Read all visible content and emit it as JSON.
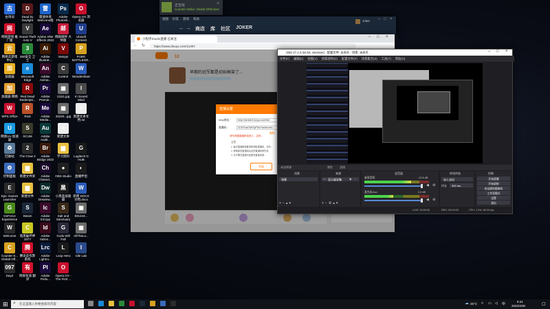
{
  "desktop": {
    "icons": [
      {
        "label": "古诗词",
        "color": "#2b6cd8",
        "glyph": "古"
      },
      {
        "label": "Dead by Daylight",
        "color": "#5a1a1a",
        "glyph": "D"
      },
      {
        "label": "雷速体育 Welcome版",
        "color": "#1e64c8",
        "glyph": "雷"
      },
      {
        "label": "Adobe Photosh...",
        "color": "#0a2a4a",
        "glyph": "Ps"
      },
      {
        "label": "Opera GX 浏览器",
        "color": "#c8102e",
        "glyph": "O"
      },
      {
        "label": "网易游戏 推广版",
        "color": "#d0102a",
        "glyph": "网"
      },
      {
        "label": "Grand Theft Auto V",
        "color": "#3a3a3a",
        "glyph": "V"
      },
      {
        "label": "Adobe After Effects 2022",
        "color": "#1a0a3a",
        "glyph": "Ae"
      },
      {
        "label": "网易邮件 大师版",
        "color": "#c81e3c",
        "glyph": "邮"
      },
      {
        "label": "Ubisoft Connect",
        "color": "#1e3c8c",
        "glyph": "U"
      },
      {
        "label": "网易云游戏 中心",
        "color": "#e0a020",
        "glyph": "云"
      },
      {
        "label": "360安全 卫士",
        "color": "#2a8a3a",
        "glyph": "3"
      },
      {
        "label": "Adobe Illustrat...",
        "color": "#3a1a00",
        "glyph": "Ai"
      },
      {
        "label": "Vampyr",
        "color": "#7a0a0a",
        "glyph": "V"
      },
      {
        "label": "PUBG BATTLEGR...",
        "color": "#d4a020",
        "glyph": "P"
      },
      {
        "label": "加速器",
        "color": "#e8b020",
        "glyph": "加"
      },
      {
        "label": "Microsoft Edge",
        "color": "#1a8ad8",
        "glyph": "e"
      },
      {
        "label": "Adobe Anima...",
        "color": "#3a0a2a",
        "glyph": "An"
      },
      {
        "label": "Control",
        "color": "#3a3a3a",
        "glyph": "C"
      },
      {
        "label": "Wondershare",
        "color": "#2a5ab8",
        "glyph": "W"
      },
      {
        "label": "加速器 网络",
        "color": "#e0a030",
        "glyph": "加"
      },
      {
        "label": "Red Dead Redempti...",
        "color": "#8a0a0a",
        "glyph": "R"
      },
      {
        "label": "Adobe Premie...",
        "color": "#1a0a3a",
        "glyph": "Pr"
      },
      {
        "label": "11111.jpg",
        "color": "#6a6a6a",
        "glyph": "▦"
      },
      {
        "label": "In Sound Mind",
        "color": "#4a4a4a",
        "glyph": "I"
      },
      {
        "label": "WPS Office",
        "color": "#c8102e",
        "glyph": "W"
      },
      {
        "label": "Rust",
        "color": "#b8502a",
        "glyph": "R"
      },
      {
        "label": "Adobe Media...",
        "color": "#1a0a3a",
        "glyph": "Me"
      },
      {
        "label": "20220...jpg",
        "color": "#6a6a6a",
        "glyph": "▦"
      },
      {
        "label": "新建文本文档.txt",
        "color": "#eeeeee",
        "glyph": "≡"
      },
      {
        "label": "网易UU 加速器",
        "color": "#1a9ae0",
        "glyph": "U"
      },
      {
        "label": "SCUM",
        "color": "#3a3a2a",
        "glyph": "S"
      },
      {
        "label": "Adobe Audit...",
        "color": "#0a3a3a",
        "glyph": "Au"
      },
      {
        "label": "新建文本",
        "color": "#eeeeee",
        "glyph": "≡"
      },
      {
        "label": "",
        "color": "#00000000",
        "glyph": ""
      },
      {
        "label": "回收站",
        "color": "#5a7a9a",
        "glyph": "♻"
      },
      {
        "label": "The Crew 2",
        "color": "#2a2a2a",
        "glyph": "2"
      },
      {
        "label": "Adobe Bridge 2022",
        "color": "#3a1a0a",
        "glyph": "Br"
      },
      {
        "label": "学习资料",
        "color": "#e8c040",
        "glyph": "▆"
      },
      {
        "label": "Logitech G HUB",
        "color": "#1a1a1a",
        "glyph": "G"
      },
      {
        "label": "控制面板",
        "color": "#3a6ab8",
        "glyph": "⚙"
      },
      {
        "label": "新建文件夹",
        "color": "#e8c040",
        "glyph": "▆"
      },
      {
        "label": "Adobe Charact...",
        "color": "#1a0a2a",
        "glyph": "Ch"
      },
      {
        "label": "OBS Studio",
        "color": "#202020",
        "glyph": "●"
      },
      {
        "label": "直播伴侣",
        "color": "#1a1a1a",
        "glyph": "◐"
      },
      {
        "label": "Epic Games Launcher",
        "color": "#2a2a2a",
        "glyph": "E"
      },
      {
        "label": "新建文件",
        "color": "#e8c040",
        "glyph": "▆"
      },
      {
        "label": "Adobe Dreamw...",
        "color": "#0a2a2a",
        "glyph": "Dw"
      },
      {
        "label": "小黑盒加速器",
        "color": "#1a1a1a",
        "glyph": "黑"
      },
      {
        "label": "新建 DOCX 文档.docx",
        "color": "#2a5ab8",
        "glyph": "W"
      },
      {
        "label": "GeForce Experience",
        "color": "#4a8a1a",
        "glyph": "G"
      },
      {
        "label": "Steam",
        "color": "#1b2838",
        "glyph": "S"
      },
      {
        "label": "Adobe InCopy",
        "color": "#3a0a2a",
        "glyph": "Ic"
      },
      {
        "label": "Salt and Sanctuary",
        "color": "#3a2a1a",
        "glyph": "S"
      },
      {
        "label": "831444...",
        "color": "#6a6a6a",
        "glyph": "▦"
      },
      {
        "label": "Welcome",
        "color": "#2a2a2a",
        "glyph": "W"
      },
      {
        "label": "暗黑破坏神2077",
        "color": "#c8c820",
        "glyph": "C"
      },
      {
        "label": "Adobe InDes...",
        "color": "#3a0a1a",
        "glyph": "Id"
      },
      {
        "label": "Gods Will Fall",
        "color": "#2a2a3a",
        "glyph": "G"
      },
      {
        "label": "AllTheLo...",
        "color": "#6a6a6a",
        "glyph": "▦"
      },
      {
        "label": "Counter-S... Global Off...",
        "color": "#d8a020",
        "glyph": "C"
      },
      {
        "label": "腾讯反作弊系统",
        "color": "#d0102a",
        "glyph": "腾"
      },
      {
        "label": "Adobe Lightro...",
        "color": "#0a1a3a",
        "glyph": "Lrc"
      },
      {
        "label": "Loop Hero",
        "color": "#1a1a1a",
        "glyph": "L"
      },
      {
        "label": "Idle Lab",
        "color": "#2a4a8a",
        "glyph": "I"
      },
      {
        "label": "DayZ",
        "color": "#2a2a2a",
        "glyph": "097"
      },
      {
        "label": "网易有道 翻译",
        "color": "#d0102a",
        "glyph": "有"
      },
      {
        "label": "Adobe Prelu...",
        "color": "#1a0a3a",
        "glyph": "Pl"
      },
      {
        "label": "Opera GX - The First ...",
        "color": "#c8102e",
        "glyph": "O"
      },
      {
        "label": "",
        "color": "#00000000",
        "glyph": ""
      }
    ]
  },
  "steam_notification": {
    "line1": "正在玩",
    "line2": "Counter-Strike: Global Offensive"
  },
  "steam": {
    "menu": [
      "视图",
      "好友",
      "游戏",
      "帮助"
    ],
    "nav": [
      "商店",
      "库",
      "社区",
      "JOKER"
    ],
    "user": "Joker"
  },
  "browser": {
    "tab_title": "小程序Studio直播 已关注",
    "url": "https://www.douyu.com/11307",
    "room_title": "早期的冠军都是初始框架了...",
    "hot_rank": "12",
    "dialog": {
      "title": "直播设置",
      "rtmp_label": "rtmp地址：",
      "rtmp_value": "rtmp://sendtc3.douyu.com/live",
      "key_label": "直播码：",
      "key_value": "11307rasGdKSyPDw?wsSecret=...",
      "copy_label": "复制",
      "warning": "请勿泄露直播码给他人，否则...",
      "note_title": "注意：",
      "note1": "1. 每次直播都需要重新获取直播码，请勿...",
      "note2": "2. 获取新的直播码后旧的直播码即失效",
      "note3": "3. 请不要在直播中途更改直播设置...",
      "ok_label": "开始"
    }
  },
  "obs": {
    "title": "OBS 27.2.3 (64-bit, windows) - 配置文件: 未命名 - 场景: 未命名",
    "menu": [
      "文件(F)",
      "编辑(E)",
      "视图(V)",
      "停靠部件(D)",
      "配置文件(P)",
      "场景集合(S)",
      "工具(T)",
      "帮助(H)"
    ],
    "source_bar": {
      "props": "属性",
      "filters": "滤镜"
    },
    "panels": {
      "scenes": "场景",
      "sources": "来源",
      "mixer": "混音器",
      "transitions": "转场特效",
      "controls": "控制"
    },
    "scene_item": "场景",
    "source_item": "显示器采集",
    "mixer": [
      {
        "name": "桌面音频",
        "db": "-12.8 dB",
        "level": 0.72
      },
      {
        "name": "麦克风/Aux",
        "db": "0.0 dB",
        "level": 0.45
      }
    ],
    "transition": {
      "type": "淡入淡出",
      "duration_label": "时长",
      "duration": "300 ms"
    },
    "controls": [
      "开始直播",
      "开始录制",
      "启动虚拟摄像机",
      "工作室模式",
      "设置",
      "退出"
    ],
    "status": {
      "live": "LIVE: 00:00:00",
      "rec": "REC: 00:00:00",
      "cpu": "CPU: 1.9%, 60.00 fps"
    }
  },
  "taskbar": {
    "search_placeholder": "在这里输入你要搜索的内容",
    "temp": "25°C",
    "time": "8:41",
    "date": "2022/4/30",
    "ime": "中"
  }
}
